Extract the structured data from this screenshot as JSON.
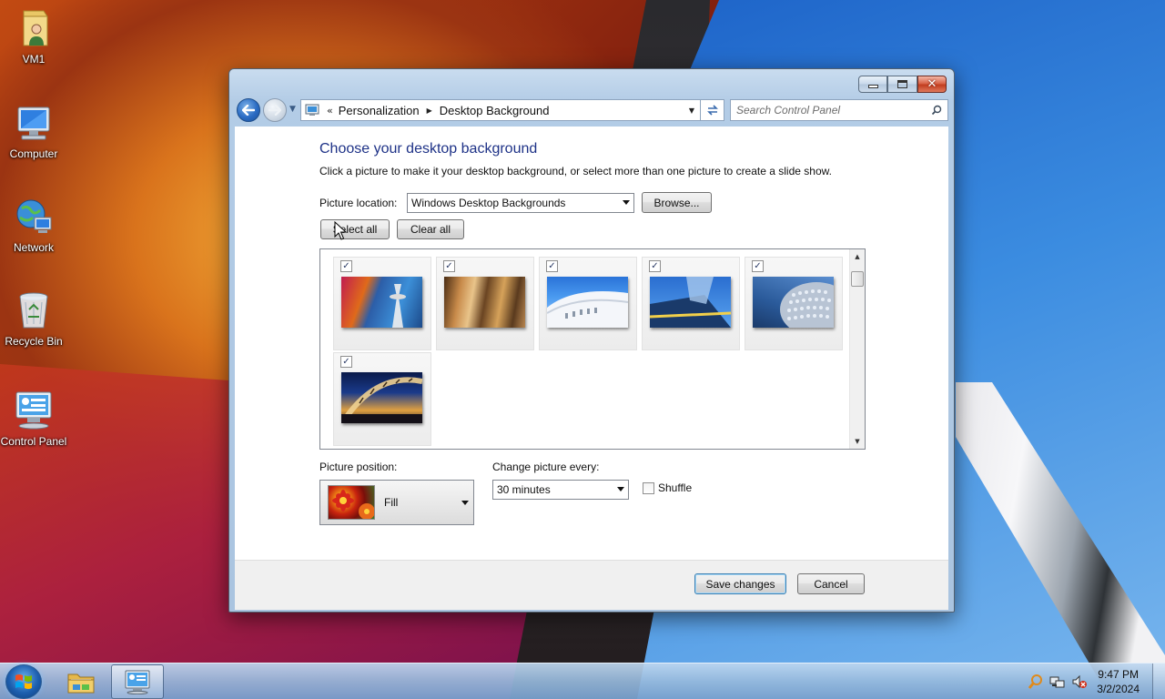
{
  "desktop": {
    "icons": [
      {
        "label": "VM1",
        "icon": "user-folder-icon"
      },
      {
        "label": "Computer",
        "icon": "computer-icon"
      },
      {
        "label": "Network",
        "icon": "network-icon"
      },
      {
        "label": "Recycle Bin",
        "icon": "recycle-bin-icon"
      },
      {
        "label": "Control Panel",
        "icon": "control-panel-icon"
      }
    ]
  },
  "window": {
    "caption_buttons": {
      "minimize": "minimize-button",
      "maximize": "maximize-button",
      "close": "close-button"
    },
    "nav": {
      "breadcrumb_overflow": "«",
      "breadcrumbs": [
        "Personalization",
        "Desktop Background"
      ],
      "search_placeholder": "Search Control Panel"
    },
    "content": {
      "title": "Choose your desktop background",
      "description": "Click a picture to make it your desktop background, or select more than one picture to create a slide show.",
      "picture_location_label": "Picture location:",
      "picture_location_value": "Windows Desktop Backgrounds",
      "browse_label": "Browse...",
      "select_all_label": "Select all",
      "clear_all_label": "Clear all",
      "pictures": [
        {
          "checked": true,
          "name": "architecture-1"
        },
        {
          "checked": true,
          "name": "architecture-2"
        },
        {
          "checked": true,
          "name": "architecture-3"
        },
        {
          "checked": true,
          "name": "architecture-4"
        },
        {
          "checked": true,
          "name": "architecture-5"
        },
        {
          "checked": true,
          "name": "architecture-6"
        }
      ],
      "picture_position_label": "Picture position:",
      "picture_position_value": "Fill",
      "change_every_label": "Change picture every:",
      "change_every_value": "30 minutes",
      "shuffle_label": "Shuffle",
      "shuffle_checked": false
    },
    "footer": {
      "save_label": "Save changes",
      "cancel_label": "Cancel"
    }
  },
  "taskbar": {
    "clock_time": "9:47 PM",
    "clock_date": "3/2/2024",
    "pinned": [
      "start-orb",
      "file-explorer",
      "control-panel"
    ]
  },
  "colors": {
    "title_blue": "#1e3287",
    "window_frame": "#aac4e0",
    "close_red": "#c13d1f"
  }
}
